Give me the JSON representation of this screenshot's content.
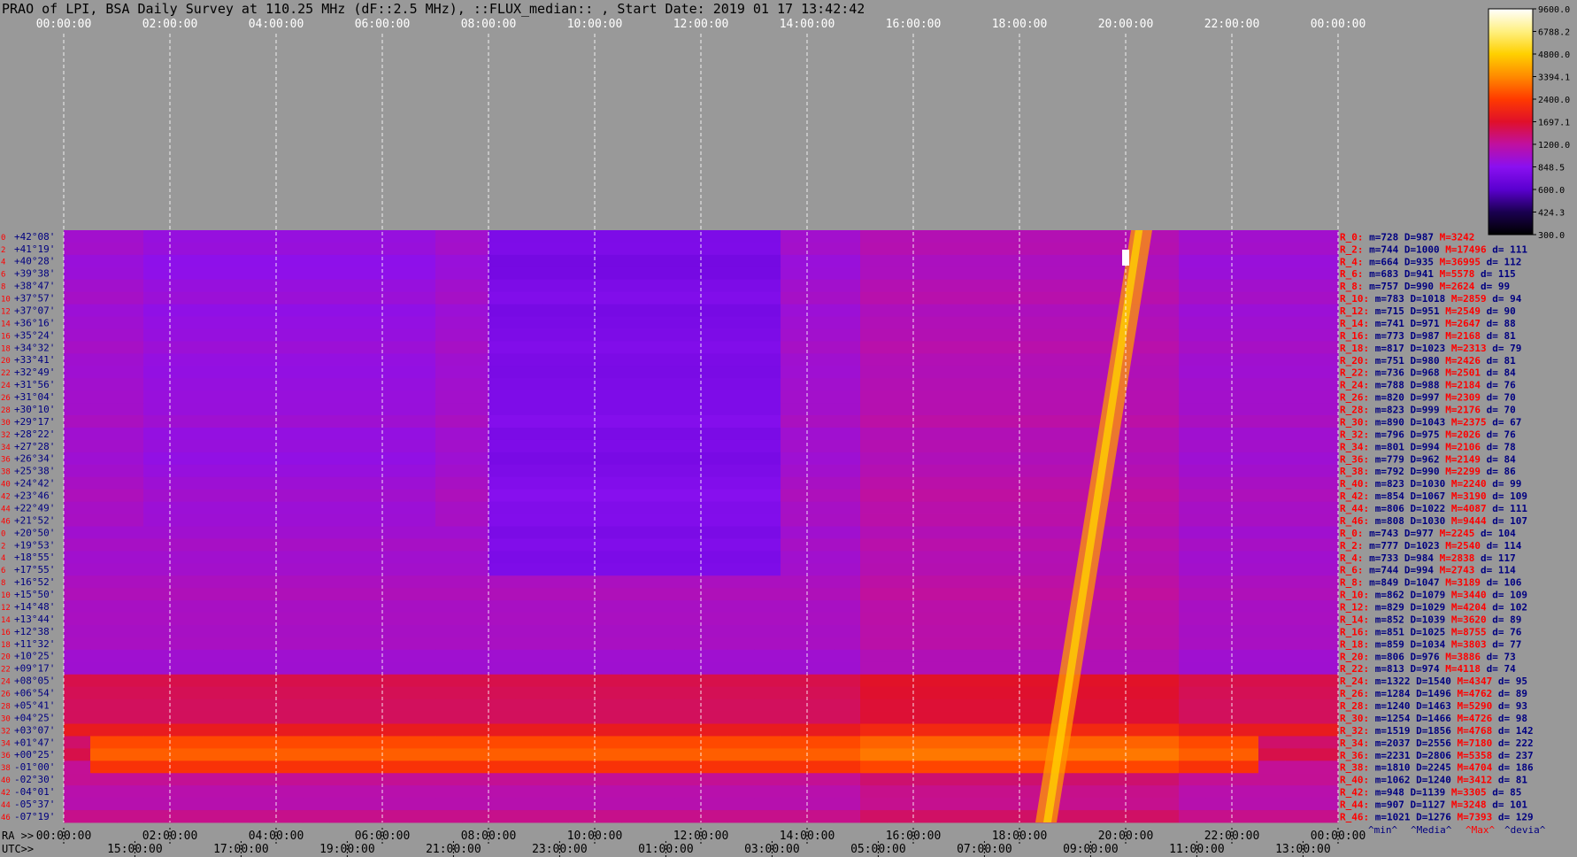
{
  "title": "PRAO of LPI, BSA Daily Survey at 110.25 MHz (dF::2.5 MHz), ::FLUX_median:: , Start Date: 2019 01 17 13:42:42",
  "chart_data": {
    "type": "heatmap",
    "title": "PRAO of LPI, BSA Daily Survey at 110.25 MHz (dF::2.5 MHz), ::FLUX_median:: , Start Date: 2019 01 17 13:42:42",
    "top_axis_labels": [
      "00:00:00",
      "02:00:00",
      "04:00:00",
      "06:00:00",
      "08:00:00",
      "10:00:00",
      "12:00:00",
      "14:00:00",
      "16:00:00",
      "18:00:00",
      "20:00:00",
      "22:00:00",
      "00:00:00"
    ],
    "ra_axis_prefix": "RA >>",
    "ra_axis_labels": [
      "00:00:00",
      "02:00:00",
      "04:00:00",
      "06:00:00",
      "08:00:00",
      "10:00:00",
      "12:00:00",
      "14:00:00",
      "16:00:00",
      "18:00:00",
      "20:00:00",
      "22:00:00",
      "00:00:00"
    ],
    "utc_axis_prefix": "UTC>>",
    "utc_axis_labels": [
      "15:00:00",
      "17:00:00",
      "19:00:00",
      "21:00:00",
      "23:00:00",
      "01:00:00",
      "03:00:00",
      "05:00:00",
      "07:00:00",
      "09:00:00",
      "11:00:00",
      "13:00:00"
    ],
    "colorbar_ticks": [
      "9600.0",
      "6788.2",
      "4800.0",
      "3394.1",
      "2400.0",
      "1697.1",
      "1200.0",
      "848.5",
      "600.0",
      "424.3",
      "300.0"
    ],
    "colorbar_colors": [
      "#000000",
      "#1a0050",
      "#5a00d0",
      "#8a10f0",
      "#c010a0",
      "#e0102a",
      "#ff3a00",
      "#ff8a00",
      "#ffd000",
      "#fff080",
      "#ffffff"
    ],
    "declinations": [
      "+42°08'",
      "+41°19'",
      "+40°28'",
      "+39°38'",
      "+38°47'",
      "+37°57'",
      "+37°07'",
      "+36°16'",
      "+35°24'",
      "+34°32'",
      "+33°41'",
      "+32°49'",
      "+31°56'",
      "+31°04'",
      "+30°10'",
      "+29°17'",
      "+28°22'",
      "+27°28'",
      "+26°34'",
      "+25°38'",
      "+24°42'",
      "+23°46'",
      "+22°49'",
      "+21°52'",
      "+20°50'",
      "+19°53'",
      "+18°55'",
      "+17°55'",
      "+16°52'",
      "+15°50'",
      "+14°48'",
      "+13°44'",
      "+12°38'",
      "+11°32'",
      "+10°25'",
      "+09°17'",
      "+08°05'",
      "+06°54'",
      "+05°41'",
      "+04°25'",
      "+03°07'",
      "+01°47'",
      "+00°25'",
      "-01°00'",
      "-02°30'",
      "-04°01'",
      "-05°37'",
      "-07°19'"
    ],
    "beam_numbers": [
      "0",
      "2",
      "4",
      "6",
      "8",
      "10",
      "12",
      "14",
      "16",
      "18",
      "20",
      "22",
      "24",
      "26",
      "28",
      "30",
      "32",
      "34",
      "36",
      "38",
      "40",
      "42",
      "44",
      "46",
      "0",
      "2",
      "4",
      "6",
      "8",
      "10",
      "12",
      "14",
      "16",
      "18",
      "20",
      "22",
      "24",
      "26",
      "28",
      "30",
      "32",
      "34",
      "36",
      "38",
      "40",
      "42",
      "44",
      "46"
    ],
    "stats": [
      {
        "r": "R_0:",
        "m": "728",
        "D": "987",
        "M": "3242",
        "d": ""
      },
      {
        "r": "R_2:",
        "m": "744",
        "D": "1000",
        "M": "17496",
        "d": "111"
      },
      {
        "r": "R_4:",
        "m": "664",
        "D": "935",
        "M": "36995",
        "d": "112"
      },
      {
        "r": "R_6:",
        "m": "683",
        "D": "941",
        "M": "5578",
        "d": "115"
      },
      {
        "r": "R_8:",
        "m": "757",
        "D": "990",
        "M": "2624",
        "d": "99"
      },
      {
        "r": "R_10:",
        "m": "783",
        "D": "1018",
        "M": "2859",
        "d": "94"
      },
      {
        "r": "R_12:",
        "m": "715",
        "D": "951",
        "M": "2549",
        "d": "90"
      },
      {
        "r": "R_14:",
        "m": "741",
        "D": "971",
        "M": "2647",
        "d": "88"
      },
      {
        "r": "R_16:",
        "m": "773",
        "D": "987",
        "M": "2168",
        "d": "81"
      },
      {
        "r": "R_18:",
        "m": "817",
        "D": "1023",
        "M": "2313",
        "d": "79"
      },
      {
        "r": "R_20:",
        "m": "751",
        "D": "980",
        "M": "2426",
        "d": "81"
      },
      {
        "r": "R_22:",
        "m": "736",
        "D": "968",
        "M": "2501",
        "d": "84"
      },
      {
        "r": "R_24:",
        "m": "788",
        "D": "988",
        "M": "2184",
        "d": "76"
      },
      {
        "r": "R_26:",
        "m": "820",
        "D": "997",
        "M": "2309",
        "d": "70"
      },
      {
        "r": "R_28:",
        "m": "823",
        "D": "999",
        "M": "2176",
        "d": "70"
      },
      {
        "r": "R_30:",
        "m": "890",
        "D": "1043",
        "M": "2375",
        "d": "67"
      },
      {
        "r": "R_32:",
        "m": "796",
        "D": "975",
        "M": "2026",
        "d": "76"
      },
      {
        "r": "R_34:",
        "m": "801",
        "D": "994",
        "M": "2106",
        "d": "78"
      },
      {
        "r": "R_36:",
        "m": "779",
        "D": "962",
        "M": "2149",
        "d": "84"
      },
      {
        "r": "R_38:",
        "m": "792",
        "D": "990",
        "M": "2299",
        "d": "86"
      },
      {
        "r": "R_40:",
        "m": "823",
        "D": "1030",
        "M": "2240",
        "d": "99"
      },
      {
        "r": "R_42:",
        "m": "854",
        "D": "1067",
        "M": "3190",
        "d": "109"
      },
      {
        "r": "R_44:",
        "m": "806",
        "D": "1022",
        "M": "4087",
        "d": "111"
      },
      {
        "r": "R_46:",
        "m": "808",
        "D": "1030",
        "M": "9444",
        "d": "107"
      },
      {
        "r": "R_0:",
        "m": "743",
        "D": "977",
        "M": "2245",
        "d": "104"
      },
      {
        "r": "R_2:",
        "m": "777",
        "D": "1023",
        "M": "2540",
        "d": "114"
      },
      {
        "r": "R_4:",
        "m": "733",
        "D": "984",
        "M": "2838",
        "d": "117"
      },
      {
        "r": "R_6:",
        "m": "744",
        "D": "994",
        "M": "2743",
        "d": "114"
      },
      {
        "r": "R_8:",
        "m": "849",
        "D": "1047",
        "M": "3189",
        "d": "106"
      },
      {
        "r": "R_10:",
        "m": "862",
        "D": "1079",
        "M": "3440",
        "d": "109"
      },
      {
        "r": "R_12:",
        "m": "829",
        "D": "1029",
        "M": "4204",
        "d": "102"
      },
      {
        "r": "R_14:",
        "m": "852",
        "D": "1039",
        "M": "3620",
        "d": "89"
      },
      {
        "r": "R_16:",
        "m": "851",
        "D": "1025",
        "M": "8755",
        "d": "76"
      },
      {
        "r": "R_18:",
        "m": "859",
        "D": "1034",
        "M": "3803",
        "d": "77"
      },
      {
        "r": "R_20:",
        "m": "806",
        "D": "976",
        "M": "3886",
        "d": "73"
      },
      {
        "r": "R_22:",
        "m": "813",
        "D": "974",
        "M": "4118",
        "d": "74"
      },
      {
        "r": "R_24:",
        "m": "1322",
        "D": "1540",
        "M": "4347",
        "d": "95"
      },
      {
        "r": "R_26:",
        "m": "1284",
        "D": "1496",
        "M": "4762",
        "d": "89"
      },
      {
        "r": "R_28:",
        "m": "1240",
        "D": "1463",
        "M": "5290",
        "d": "93"
      },
      {
        "r": "R_30:",
        "m": "1254",
        "D": "1466",
        "M": "4726",
        "d": "98"
      },
      {
        "r": "R_32:",
        "m": "1519",
        "D": "1856",
        "M": "4768",
        "d": "142"
      },
      {
        "r": "R_34:",
        "m": "2037",
        "D": "2556",
        "M": "7180",
        "d": "222"
      },
      {
        "r": "R_36:",
        "m": "2231",
        "D": "2806",
        "M": "5358",
        "d": "237"
      },
      {
        "r": "R_38:",
        "m": "1810",
        "D": "2245",
        "M": "4704",
        "d": "186"
      },
      {
        "r": "R_40:",
        "m": "1062",
        "D": "1240",
        "M": "3412",
        "d": "81"
      },
      {
        "r": "R_42:",
        "m": "948",
        "D": "1139",
        "M": "3305",
        "d": "85"
      },
      {
        "r": "R_44:",
        "m": "907",
        "D": "1127",
        "M": "3248",
        "d": "101"
      },
      {
        "r": "R_46:",
        "m": "1021",
        "D": "1276",
        "M": "7393",
        "d": "129"
      }
    ],
    "stat_legend": [
      "^min^",
      "^Media^",
      "^Max^",
      "^devia^"
    ],
    "stat_legend_colors": [
      "#000080",
      "#000080",
      "#ff0000",
      "#000080"
    ],
    "colors": {
      "background": "#999999",
      "text": "#000000",
      "beam_number": "#ff0000",
      "declination": "#000080",
      "stat_red": "#ff0000",
      "stat_blue": "#000080",
      "axis_top_text": "#ffffff",
      "axis_bottom_text": "#000000"
    }
  }
}
